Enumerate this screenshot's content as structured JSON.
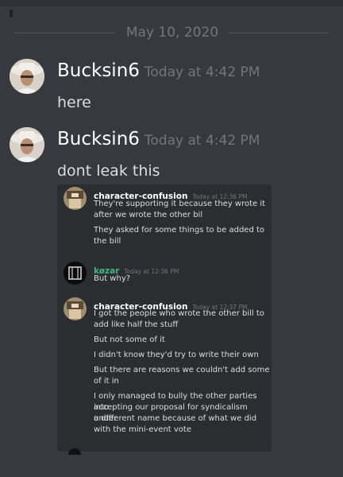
{
  "date_divider": "May 10, 2020",
  "messages": [
    {
      "username": "Bucksin6",
      "timestamp": "Today at 4:42 PM",
      "content": "here"
    },
    {
      "username": "Bucksin6",
      "timestamp": "Today at 4:42 PM",
      "content": "dont leak this"
    }
  ],
  "embedded_screenshot": {
    "messages": [
      {
        "username": "character-confusion",
        "timestamp": "Today at 12:36 PM",
        "lines": [
          "They're supporting it because they wrote it",
          "after we wrote the other bil",
          "They asked for some things to be added to",
          "the bill"
        ]
      },
      {
        "username": "køzar",
        "timestamp": "Today at 12:36 PM",
        "lines": [
          "But why?"
        ]
      },
      {
        "username": "character-confusion",
        "timestamp": "Today at 12:37 PM",
        "lines": [
          "I got the people who wrote the other bill to",
          "add like half the stuff",
          "But not some of it",
          "I didn't know they'd try to write their own",
          "But there are reasons we couldn't add some",
          "of it in",
          "I only managed to bully the other parties into",
          "accepting our proposal for syndicalism under",
          "a different name because of what we did",
          "with the mini-event vote"
        ]
      }
    ]
  },
  "colors": {
    "background": "#36393f",
    "username": "#ffffff",
    "timestamp": "#72767d",
    "text": "#dcddde",
    "kozar_name": "#43b581"
  }
}
